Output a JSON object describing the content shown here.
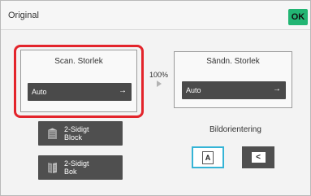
{
  "header": {
    "title": "Original",
    "ok_label": "OK"
  },
  "scan_size": {
    "label": "Scan. Storlek",
    "value": "Auto",
    "highlighted": true
  },
  "send_size": {
    "label": "Sändn. Storlek",
    "value": "Auto"
  },
  "ratio": "100%",
  "duplex": {
    "block_line1": "2-Sidigt",
    "block_line2": "Block",
    "book_line1": "2-Sidigt",
    "book_line2": "Bok"
  },
  "orientation": {
    "label": "Bildorientering",
    "portrait_glyph": "A",
    "landscape_glyph": "<",
    "selected": "portrait"
  },
  "colors": {
    "ok_green": "#22b573",
    "highlight_red": "#e3242b",
    "selected_blue": "#35b4d6",
    "button_dark": "#4a4a4a"
  },
  "icons": {
    "arrow": "arrow-right-icon",
    "block": "duplex-block-icon",
    "book": "duplex-book-icon",
    "ratio": "triangle-right-icon"
  }
}
